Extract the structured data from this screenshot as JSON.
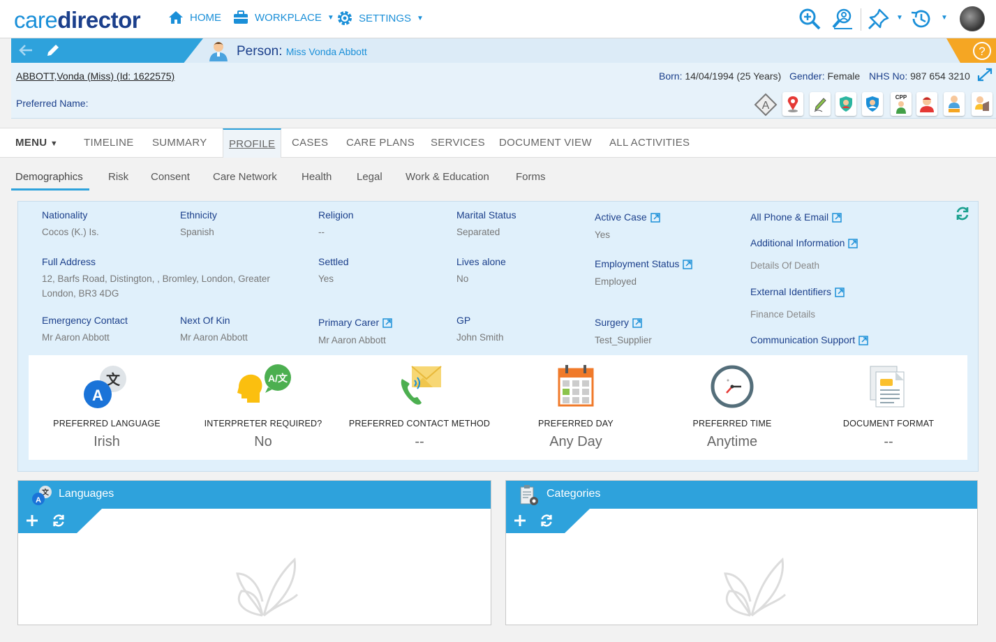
{
  "app": {
    "logo_light": "care",
    "logo_dark": "director"
  },
  "nav": {
    "home": "HOME",
    "workplace": "WORKPLACE",
    "settings": "SETTINGS"
  },
  "person": {
    "title_label": "Person:",
    "title_name": "Miss Vonda Abbott",
    "id_link": "ABBOTT,Vonda (Miss) (Id: 1622575)",
    "born_label": "Born:",
    "born_value": "14/04/1994 (25 Years)",
    "gender_label": "Gender:",
    "gender_value": "Female",
    "nhs_label": "NHS No:",
    "nhs_value": "987 654 3210",
    "preferred_name_label": "Preferred Name:"
  },
  "tabs": {
    "menu": "MENU",
    "items": [
      "TIMELINE",
      "SUMMARY",
      "PROFILE",
      "CASES",
      "CARE PLANS",
      "SERVICES",
      "DOCUMENT VIEW",
      "ALL ACTIVITIES"
    ],
    "active": "PROFILE"
  },
  "subtabs": {
    "items": [
      "Demographics",
      "Risk",
      "Consent",
      "Care Network",
      "Health",
      "Legal",
      "Work & Education",
      "Forms"
    ],
    "active": "Demographics"
  },
  "demographics": {
    "nationality": {
      "label": "Nationality",
      "value": "Cocos (K.) Is."
    },
    "ethnicity": {
      "label": "Ethnicity",
      "value": "Spanish"
    },
    "religion": {
      "label": "Religion",
      "value": "--"
    },
    "marital_status": {
      "label": "Marital Status",
      "value": "Separated"
    },
    "active_case": {
      "label": "Active Case",
      "value": "Yes"
    },
    "full_address": {
      "label": "Full Address",
      "value_line1": "12, Barfs Road, Distington, , Bromley, London, Greater",
      "value_line2": "London, BR3 4DG"
    },
    "settled": {
      "label": "Settled",
      "value": "Yes"
    },
    "lives_alone": {
      "label": "Lives alone",
      "value": "No"
    },
    "employment_status": {
      "label": "Employment Status",
      "value": "Employed"
    },
    "emergency_contact": {
      "label": "Emergency Contact",
      "value": "Mr Aaron Abbott"
    },
    "next_of_kin": {
      "label": "Next Of Kin",
      "value": "Mr Aaron Abbott"
    },
    "primary_carer": {
      "label": "Primary Carer",
      "value": "Mr Aaron Abbott"
    },
    "gp": {
      "label": "GP",
      "value": "John Smith"
    },
    "surgery": {
      "label": "Surgery",
      "value": "Test_Supplier"
    },
    "links": {
      "all_phone_email": "All Phone & Email",
      "additional_information": "Additional Information",
      "details_of_death": "Details Of Death",
      "external_identifiers": "External Identifiers",
      "finance_details": "Finance Details",
      "communication_support": "Communication Support"
    }
  },
  "preferences": [
    {
      "label": "PREFERRED LANGUAGE",
      "value": "Irish"
    },
    {
      "label": "INTERPRETER REQUIRED?",
      "value": "No"
    },
    {
      "label": "PREFERRED CONTACT METHOD",
      "value": "--"
    },
    {
      "label": "PREFERRED DAY",
      "value": "Any Day"
    },
    {
      "label": "PREFERRED TIME",
      "value": "Anytime"
    },
    {
      "label": "DOCUMENT FORMAT",
      "value": "--"
    }
  ],
  "panels": {
    "languages": {
      "title": "Languages"
    },
    "categories": {
      "title": "Categories"
    }
  },
  "colors": {
    "primary": "#2ea2dc",
    "navy": "#1b3f8b",
    "accent_orange": "#f5a623",
    "light_bg": "#e0f0fb"
  }
}
